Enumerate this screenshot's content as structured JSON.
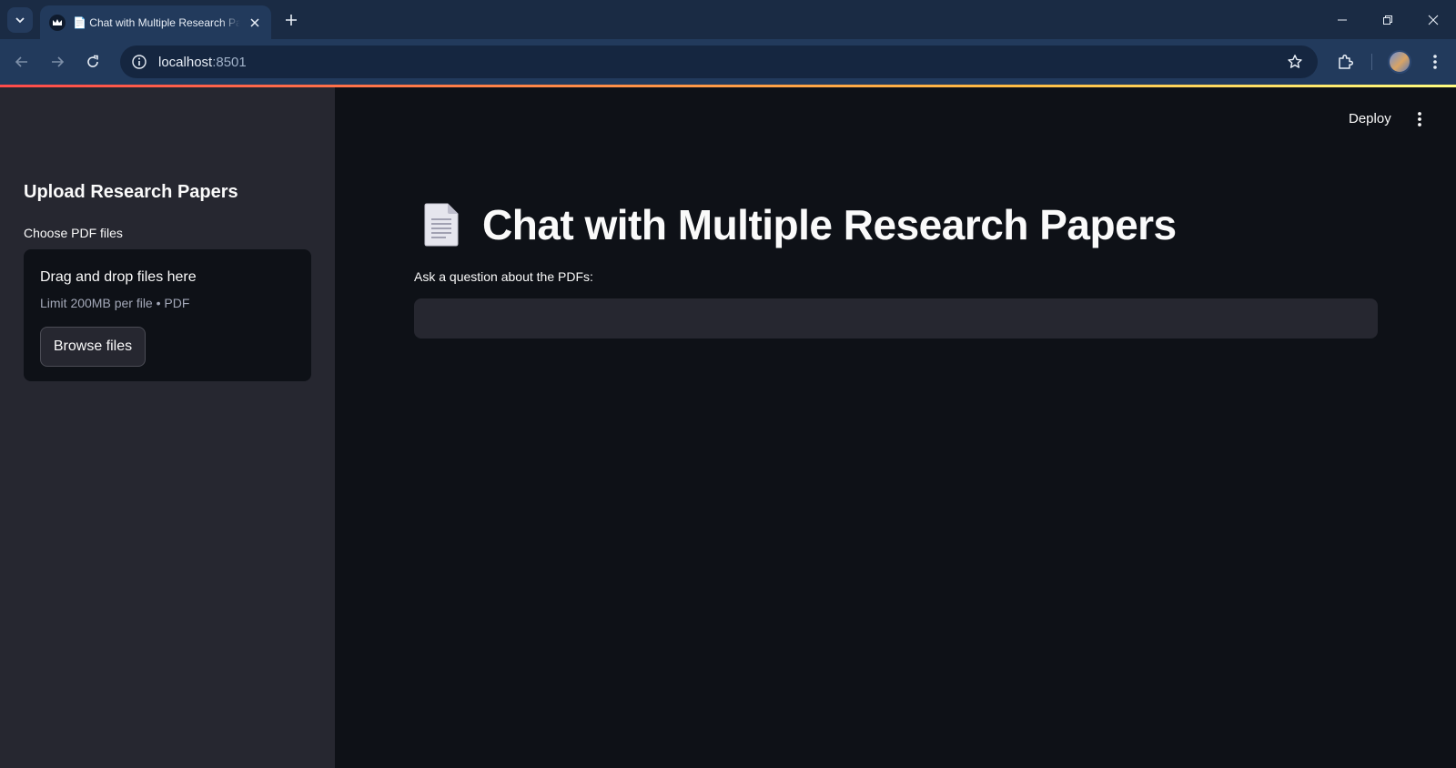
{
  "browser": {
    "tab": {
      "title": "📄 Chat with Multiple Research Papers",
      "favicon": "streamlit-crown-icon"
    },
    "address": {
      "host": "localhost",
      "port": ":8501"
    },
    "colors": {
      "tabbar": "#1a2b44",
      "toolbar": "#223a5c",
      "omnibox": "#152640"
    }
  },
  "sidebar": {
    "heading": "Upload Research Papers",
    "uploader": {
      "label": "Choose PDF files",
      "dropzone_title": "Drag and drop files here",
      "limit_text": "Limit 200MB per file • PDF",
      "browse_label": "Browse files"
    }
  },
  "header": {
    "deploy_label": "Deploy"
  },
  "main": {
    "title_icon": "page-document-icon",
    "title": "Chat with Multiple Research Papers",
    "question": {
      "label": "Ask a question about the PDFs:",
      "value": ""
    }
  },
  "theme": {
    "background": "#0e1117",
    "secondary_background": "#262730",
    "text": "#fafafa",
    "decoration_gradient": [
      "#ff4b4b",
      "#ffbd45",
      "#fffd80"
    ]
  }
}
